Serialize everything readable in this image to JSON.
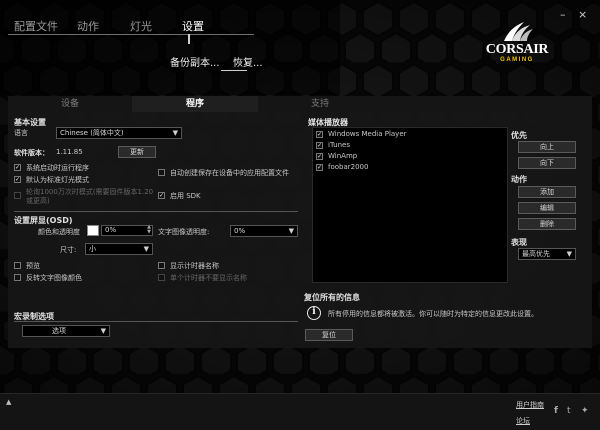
{
  "window": {
    "minimize": "–",
    "close": "×"
  },
  "nav": {
    "items": [
      {
        "label": "配置文件",
        "active": false
      },
      {
        "label": "动作",
        "active": false
      },
      {
        "label": "灯光",
        "active": false
      },
      {
        "label": "设置",
        "active": true
      }
    ],
    "backup_label": "备份副本...",
    "restore_label": "恢复..."
  },
  "logo": {
    "brand": "CORSAIR",
    "sub": "GAMING"
  },
  "tabs": [
    {
      "label": "设备",
      "active": false
    },
    {
      "label": "程序",
      "active": true
    },
    {
      "label": "支持",
      "active": false
    }
  ],
  "basic": {
    "title": "基本设置",
    "language_label": "语言",
    "language_value": "Chinese (简体中文)",
    "version_label": "软件版本：",
    "version_value": "1.11.85",
    "update_button": "更新",
    "cb_startup": {
      "label": "系统启动时运行程序",
      "checked": true
    },
    "cb_default_light": {
      "label": "默认为标准灯光模式",
      "checked": true
    },
    "cb_1000hz": {
      "label": "轮询1000万次时模式(需要固件版本1.20或更高)",
      "checked": false
    },
    "cb_autosave": {
      "label": "自动创建保存在设备中的应用配置文件",
      "checked": false
    },
    "cb_sdk": {
      "label": "启用 SDK",
      "checked": true
    }
  },
  "osd": {
    "title": "设置屏显(OSD)",
    "color_label": "颜色和透明度",
    "color_value": "0%",
    "text_label": "文字图像透明度:",
    "text_value": "0%",
    "size_label": "尺寸:",
    "size_value": "小",
    "cb_preview": {
      "label": "预览",
      "checked": false
    },
    "cb_invert": {
      "label": "反转文字图像颜色",
      "checked": false
    },
    "cb_show_timer": {
      "label": "显示计时器名称",
      "checked": false
    },
    "cb_single_timer": {
      "label": "单个计时器不要显示名称",
      "checked": false
    }
  },
  "macro": {
    "title": "宏录制选项",
    "select_value": "选项"
  },
  "media": {
    "title": "媒体播放器",
    "players": [
      {
        "name": "Windows Media Player",
        "checked": true
      },
      {
        "name": "iTunes",
        "checked": true
      },
      {
        "name": "WinAmp",
        "checked": true
      },
      {
        "name": "foobar2000",
        "checked": true
      }
    ]
  },
  "priority": {
    "title": "优先",
    "up": "向上",
    "down": "向下"
  },
  "actions": {
    "title": "动作",
    "add": "添加",
    "edit": "编辑",
    "delete": "删除"
  },
  "display": {
    "title": "表现",
    "value": "最高优先"
  },
  "reset": {
    "title": "复位所有的信息",
    "message": "所有停用的信息都将被激活。你可以随时为特定的信息更改此设置。",
    "button": "复位"
  },
  "footer": {
    "arrow": "▲",
    "guide_link": "用户指南",
    "forum_link": "论坛",
    "social": {
      "facebook": "f",
      "twitter": "t",
      "corsair": "✦"
    }
  }
}
